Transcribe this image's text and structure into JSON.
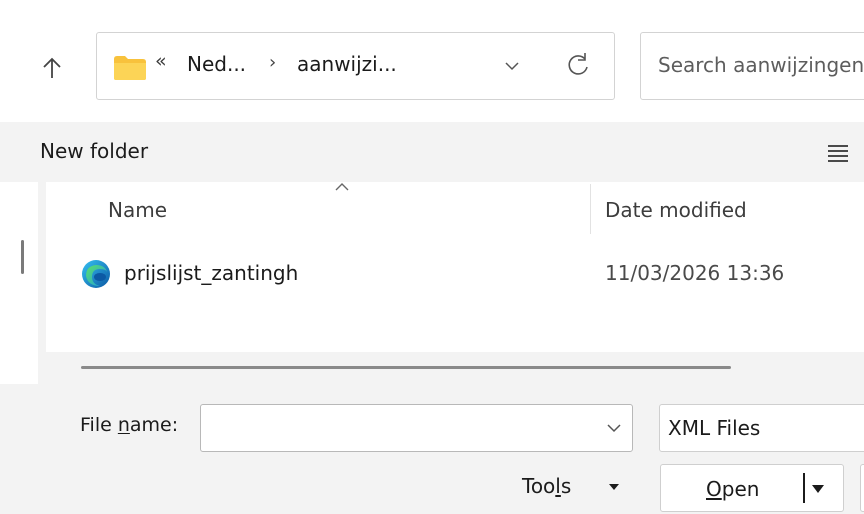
{
  "address": {
    "chevron_left": "«",
    "crumb1": "Ned...",
    "separator": "›",
    "crumb2": "aanwijzi...",
    "folder_color": "#f8c23c"
  },
  "search": {
    "placeholder": "Search aanwijzingen"
  },
  "toolbar": {
    "new_folder": "New folder"
  },
  "columns": {
    "name": "Name",
    "date_modified": "Date modified"
  },
  "files": [
    {
      "name": "prijslijst_zantingh",
      "date": "11/03/2026 13:36",
      "icon": "edge-icon"
    }
  ],
  "bottom": {
    "file_name_prefix": "File ",
    "file_name_hotkey": "n",
    "file_name_suffix": "ame:",
    "file_name_value": "",
    "file_type": "XML Files",
    "tools_pre": "Too",
    "tools_hotkey": "l",
    "tools_post": "s",
    "open_hotkey": "O",
    "open_rest": "pen"
  }
}
